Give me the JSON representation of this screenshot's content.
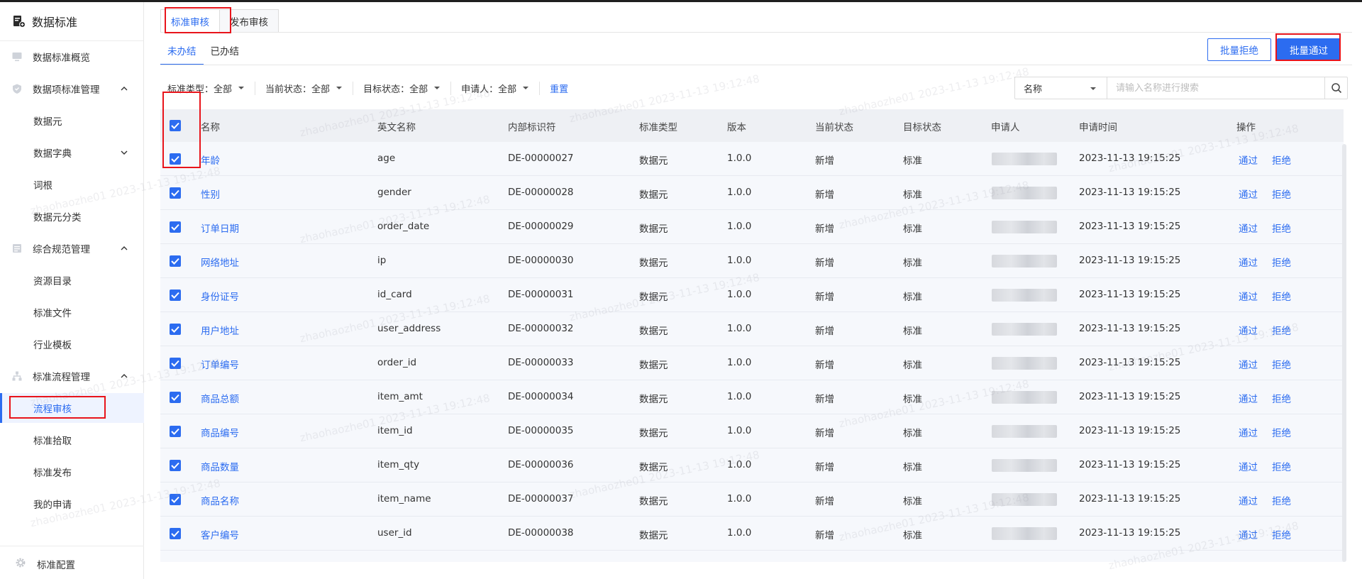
{
  "app": {
    "title": "数据标准"
  },
  "sidebar": {
    "items": [
      {
        "label": "数据标准概览",
        "icon": "monitor-icon",
        "type": "top"
      },
      {
        "label": "数据项标准管理",
        "icon": "shield-icon",
        "type": "group",
        "expanded": true
      },
      {
        "label": "数据元",
        "type": "sub"
      },
      {
        "label": "数据字典",
        "type": "sub",
        "expandable": true
      },
      {
        "label": "词根",
        "type": "sub"
      },
      {
        "label": "数据元分类",
        "type": "sub"
      },
      {
        "label": "综合规范管理",
        "icon": "document-icon",
        "type": "group",
        "expanded": true
      },
      {
        "label": "资源目录",
        "type": "sub"
      },
      {
        "label": "标准文件",
        "type": "sub"
      },
      {
        "label": "行业模板",
        "type": "sub"
      },
      {
        "label": "标准流程管理",
        "icon": "hierarchy-icon",
        "type": "group",
        "expanded": true
      },
      {
        "label": "流程审核",
        "type": "sub",
        "active": true
      },
      {
        "label": "标准拾取",
        "type": "sub"
      },
      {
        "label": "标准发布",
        "type": "sub"
      },
      {
        "label": "我的申请",
        "type": "sub"
      }
    ],
    "footer": {
      "label": "标准配置",
      "icon": "gear-icon"
    }
  },
  "tabs": [
    {
      "label": "标准审核",
      "active": true
    },
    {
      "label": "发布审核",
      "active": false
    }
  ],
  "subtabs": [
    {
      "label": "未办结",
      "active": true
    },
    {
      "label": "已办结",
      "active": false
    }
  ],
  "actions": {
    "batch_reject": "批量拒绝",
    "batch_pass": "批量通过"
  },
  "filters": {
    "items": [
      {
        "label": "标准类型：",
        "value": "全部"
      },
      {
        "label": "当前状态：",
        "value": "全部"
      },
      {
        "label": "目标状态：",
        "value": "全部"
      },
      {
        "label": "申请人：",
        "value": "全部"
      }
    ],
    "reset": "重置"
  },
  "search": {
    "field": "名称",
    "placeholder": "请输入名称进行搜索"
  },
  "table": {
    "columns": [
      "名称",
      "英文名称",
      "内部标识符",
      "标准类型",
      "版本",
      "当前状态",
      "目标状态",
      "申请人",
      "申请时间",
      "操作"
    ],
    "action_pass": "通过",
    "action_reject": "拒绝",
    "rows": [
      {
        "name": "年龄",
        "en": "age",
        "id": "DE-00000027",
        "type": "数据元",
        "version": "1.0.0",
        "current": "新增",
        "target": "标准",
        "time": "2023-11-13 19:15:25"
      },
      {
        "name": "性别",
        "en": "gender",
        "id": "DE-00000028",
        "type": "数据元",
        "version": "1.0.0",
        "current": "新增",
        "target": "标准",
        "time": "2023-11-13 19:15:25"
      },
      {
        "name": "订单日期",
        "en": "order_date",
        "id": "DE-00000029",
        "type": "数据元",
        "version": "1.0.0",
        "current": "新增",
        "target": "标准",
        "time": "2023-11-13 19:15:25"
      },
      {
        "name": "网络地址",
        "en": "ip",
        "id": "DE-00000030",
        "type": "数据元",
        "version": "1.0.0",
        "current": "新增",
        "target": "标准",
        "time": "2023-11-13 19:15:25"
      },
      {
        "name": "身份证号",
        "en": "id_card",
        "id": "DE-00000031",
        "type": "数据元",
        "version": "1.0.0",
        "current": "新增",
        "target": "标准",
        "time": "2023-11-13 19:15:25"
      },
      {
        "name": "用户地址",
        "en": "user_address",
        "id": "DE-00000032",
        "type": "数据元",
        "version": "1.0.0",
        "current": "新增",
        "target": "标准",
        "time": "2023-11-13 19:15:25"
      },
      {
        "name": "订单编号",
        "en": "order_id",
        "id": "DE-00000033",
        "type": "数据元",
        "version": "1.0.0",
        "current": "新增",
        "target": "标准",
        "time": "2023-11-13 19:15:25"
      },
      {
        "name": "商品总额",
        "en": "item_amt",
        "id": "DE-00000034",
        "type": "数据元",
        "version": "1.0.0",
        "current": "新增",
        "target": "标准",
        "time": "2023-11-13 19:15:25"
      },
      {
        "name": "商品编号",
        "en": "item_id",
        "id": "DE-00000035",
        "type": "数据元",
        "version": "1.0.0",
        "current": "新增",
        "target": "标准",
        "time": "2023-11-13 19:15:25"
      },
      {
        "name": "商品数量",
        "en": "item_qty",
        "id": "DE-00000036",
        "type": "数据元",
        "version": "1.0.0",
        "current": "新增",
        "target": "标准",
        "time": "2023-11-13 19:15:25"
      },
      {
        "name": "商品名称",
        "en": "item_name",
        "id": "DE-00000037",
        "type": "数据元",
        "version": "1.0.0",
        "current": "新增",
        "target": "标准",
        "time": "2023-11-13 19:15:25"
      },
      {
        "name": "客户编号",
        "en": "user_id",
        "id": "DE-00000038",
        "type": "数据元",
        "version": "1.0.0",
        "current": "新增",
        "target": "标准",
        "time": "2023-11-13 19:15:25"
      }
    ]
  },
  "watermark": "zhaohaozhe01 2023-11-13 19:12:48",
  "colors": {
    "accent": "#2c6cf0",
    "highlight": "#e8141b",
    "header_bg": "#eef0f4",
    "row_bg": "#f6f8fc"
  }
}
